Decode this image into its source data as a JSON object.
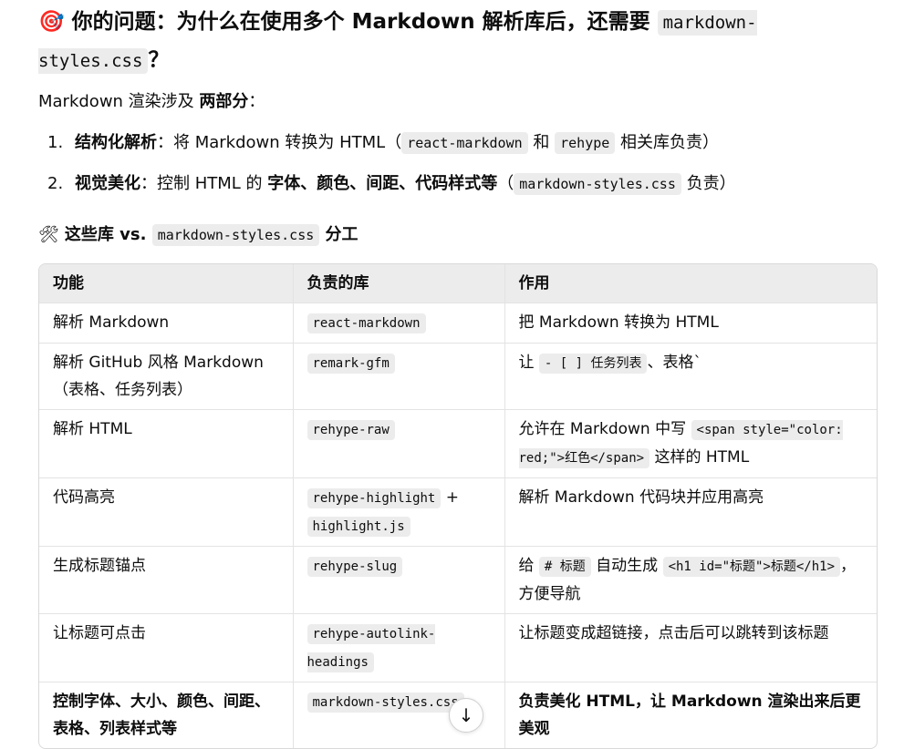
{
  "heading": {
    "icon": "target-icon",
    "emoji": "🎯",
    "prefix": "你的问题：为什么在使用多个 Markdown 解析库后，还需要 ",
    "code": "markdown-styles.css",
    "suffix": "？"
  },
  "intro": {
    "text": "Markdown 渲染涉及 ",
    "bold": "两部分",
    "end": "："
  },
  "parts": [
    {
      "num": "1.",
      "title": "结构化解析",
      "text": "：将 Markdown 转换为 HTML（",
      "code1": "react-markdown",
      "mid": " 和 ",
      "code2": "rehype",
      "end": " 相关库负责）"
    },
    {
      "num": "2.",
      "title": "视觉美化",
      "text": "：控制 HTML 的 ",
      "bold": "字体、颜色、间距、代码样式等",
      "mid": "（",
      "code1": "markdown-styles.css",
      "end": " 负责）"
    }
  ],
  "subheading": {
    "icon": "tools-icon",
    "emoji": "🛠",
    "prefix": "这些库 vs. ",
    "code": "markdown-styles.css",
    "suffix": " 分工"
  },
  "table": {
    "headers": [
      "功能",
      "负责的库",
      "作用"
    ],
    "rows": [
      {
        "func": "解析 Markdown",
        "lib": "react-markdown",
        "effect": "把 Markdown 转换为 HTML"
      },
      {
        "func": "解析 GitHub 风格 Markdown（表格、任务列表）",
        "lib": "remark-gfm",
        "effect_pre": "让 ",
        "effect_code": "- [ ] 任务列表",
        "effect_post": "、表格`"
      },
      {
        "func": "解析 HTML",
        "lib": "rehype-raw",
        "effect_pre": "允许在 Markdown 中写 ",
        "effect_code": "<span style=\"color: red;\">红色</span>",
        "effect_post": " 这样的 HTML"
      },
      {
        "func": "代码高亮",
        "lib": "rehype-highlight",
        "lib_mid": " + ",
        "lib2": "highlight.js",
        "effect": "解析 Markdown 代码块并应用高亮"
      },
      {
        "func": "生成标题锚点",
        "lib": "rehype-slug",
        "effect_pre": "给 ",
        "effect_code": "# 标题",
        "effect_mid": " 自动生成 ",
        "effect_code2": "<h1 id=\"标题\">标题</h1>",
        "effect_post": "，方便导航"
      },
      {
        "func": "让标题可点击",
        "lib": "rehype-autolink-headings",
        "effect": "让标题变成超链接，点击后可以跳转到该标题"
      },
      {
        "func": "控制字体、大小、颜色、间距、表格、列表样式等",
        "lib": "markdown-styles.css",
        "effect": "负责美化 HTML，让 Markdown 渲染出来后更美观"
      }
    ]
  },
  "scroll_button": {
    "icon": "arrow-down-icon",
    "glyph": "↓"
  }
}
